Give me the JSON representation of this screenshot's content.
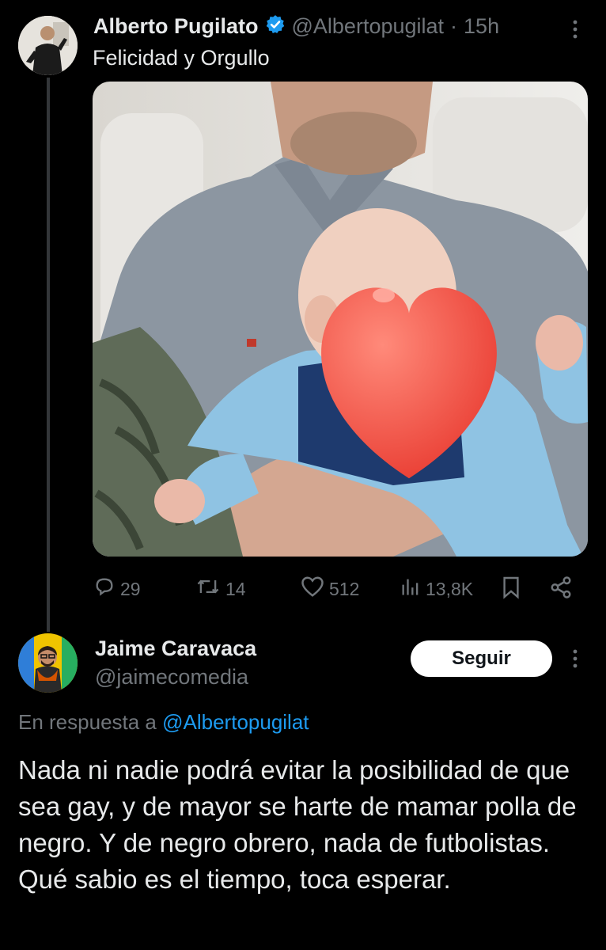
{
  "original_tweet": {
    "author_name": "Alberto Pugilato",
    "handle": "@Albertopugilat",
    "separator": "·",
    "time": "15h",
    "text": "Felicidad y Orgullo",
    "stats": {
      "replies": "29",
      "reposts": "14",
      "likes": "512",
      "views": "13,8K"
    }
  },
  "reply": {
    "author_name": "Jaime Caravaca",
    "handle": "@jaimecomedia",
    "follow_label": "Seguir",
    "in_reply_prefix": "En respuesta a",
    "in_reply_handle": "@Albertopugilat",
    "text": "Nada ni nadie podrá evitar la posibilidad de que sea gay, y de mayor se harte de mamar polla de negro. Y de negro obrero, nada de futbolistas. Qué sabio es el tiempo, toca esperar."
  },
  "colors": {
    "background": "#000000",
    "text_primary": "#e7e9ea",
    "text_secondary": "#71767b",
    "link": "#1d9bf0",
    "verified": "#1d9bf0",
    "heart_emoji": "#f2504b"
  },
  "icons": [
    "more-icon",
    "verified-icon",
    "reply-icon",
    "repost-icon",
    "like-icon",
    "views-icon",
    "bookmark-icon",
    "share-icon"
  ]
}
